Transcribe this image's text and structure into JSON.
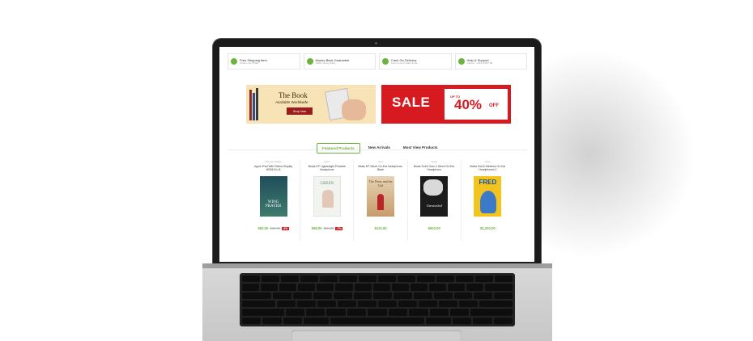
{
  "features": [
    {
      "title": "Free Shipping Item",
      "sub": "Orders over $100",
      "icon": "truck-icon"
    },
    {
      "title": "Money Back Guarantee",
      "sub": "100% money back",
      "icon": "refresh-icon"
    },
    {
      "title": "Cash On Delivery",
      "sub": "Lorem ipsum dolor amet",
      "icon": "cash-icon"
    },
    {
      "title": "Help & Support",
      "sub": "Call us : +0123.4567.89",
      "icon": "support-icon"
    }
  ],
  "banner_left": {
    "title": "The Book",
    "subtitle": "Available Worldwide",
    "button": "Shop Now"
  },
  "banner_right": {
    "sale": "SALE",
    "upto": "UP TO",
    "percent": "40%",
    "off": "OFF"
  },
  "tabs": [
    "Featured Products",
    "New Arrivals",
    "Most View Products"
  ],
  "products": [
    {
      "category": "Ultimate Edition",
      "name": "Apple iPad With Retina Display MD510LL/A",
      "price": "$50.00",
      "old_price": "$52.00",
      "discount": "-8%",
      "cover_title": "WING PRAYER",
      "cover_color": "#1f4d5a"
    },
    {
      "category": "Apple",
      "name": "Beats EP Lightweight Portable Headphone",
      "price": "$86.00",
      "old_price": "$92.00",
      "discount": "-7%",
      "cover_title": "GREEN",
      "cover_color": "#f1f3ee"
    },
    {
      "category": "Asus",
      "name": "Beats EP Wired On-Ear Headphone-Black",
      "price": "$122.00",
      "old_price": "",
      "discount": "",
      "cover_title": "The Dress and the Girl",
      "cover_color": "#d7b38a"
    },
    {
      "category": "Apple",
      "name": "Beats Solo2 Solo 2 Wired On-Ear Headphone",
      "price": "$602.00",
      "old_price": "",
      "discount": "",
      "cover_title": "Unraveled",
      "cover_color": "#1c1c1c"
    },
    {
      "category": "Asus",
      "name": "Beats Solo3 Wireless On-Ear Headphones 2",
      "price": "$1,202.00",
      "old_price": "",
      "discount": "",
      "cover_title": "FRED",
      "cover_color": "#f3c41d"
    }
  ]
}
